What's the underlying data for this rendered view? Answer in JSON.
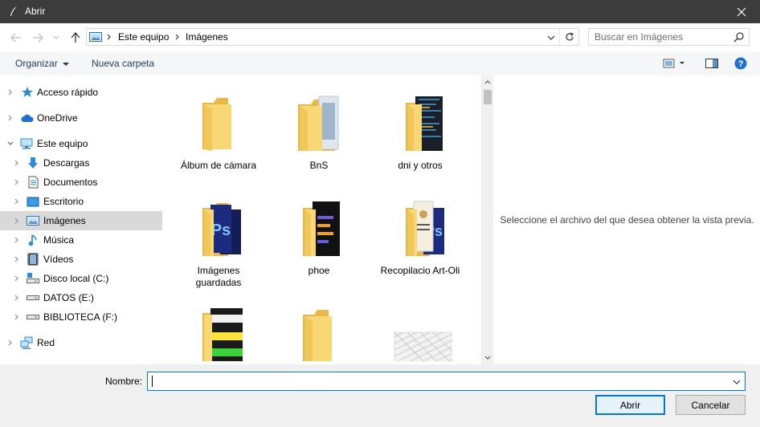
{
  "window": {
    "title": "Abrir"
  },
  "address": {
    "crumbs": [
      "Este equipo",
      "Imágenes"
    ],
    "search_placeholder": "Buscar en Imágenes"
  },
  "toolbar": {
    "organize_label": "Organizar",
    "new_folder_label": "Nueva carpeta"
  },
  "sidebar": {
    "items": [
      {
        "label": "Acceso rápido",
        "icon": "star-icon"
      },
      {
        "label": "OneDrive",
        "icon": "cloud-icon"
      },
      {
        "label": "Este equipo",
        "icon": "computer-icon"
      },
      {
        "label": "Descargas",
        "icon": "download-icon"
      },
      {
        "label": "Documentos",
        "icon": "document-icon"
      },
      {
        "label": "Escritorio",
        "icon": "desktop-icon"
      },
      {
        "label": "Imágenes",
        "icon": "pictures-icon",
        "selected": true
      },
      {
        "label": "Música",
        "icon": "music-icon"
      },
      {
        "label": "Vídeos",
        "icon": "video-icon"
      },
      {
        "label": "Disco local (C:)",
        "icon": "drive-c-icon"
      },
      {
        "label": "DATOS (E:)",
        "icon": "drive-icon"
      },
      {
        "label": "BIBLIOTECA (F:)",
        "icon": "drive-icon"
      },
      {
        "label": "Red",
        "icon": "network-icon"
      }
    ]
  },
  "files": [
    {
      "label": "Álbum de cámara"
    },
    {
      "label": "BnS"
    },
    {
      "label": "dni y otros"
    },
    {
      "label": "Imágenes guardadas"
    },
    {
      "label": "phoe"
    },
    {
      "label": "Recopilacio Art-Oli"
    },
    {
      "label": ""
    },
    {
      "label": ""
    },
    {
      "label": ""
    }
  ],
  "preview": {
    "message": "Seleccione el archivo del que desea obtener la vista previa."
  },
  "footer": {
    "name_label": "Nombre:",
    "name_value": "",
    "open_label": "Abrir",
    "cancel_label": "Cancelar"
  },
  "colors": {
    "folder": "#f8d775",
    "folder_dark": "#e8b94a",
    "accent": "#0078d7",
    "selected_nav": "#d9d9d9"
  }
}
